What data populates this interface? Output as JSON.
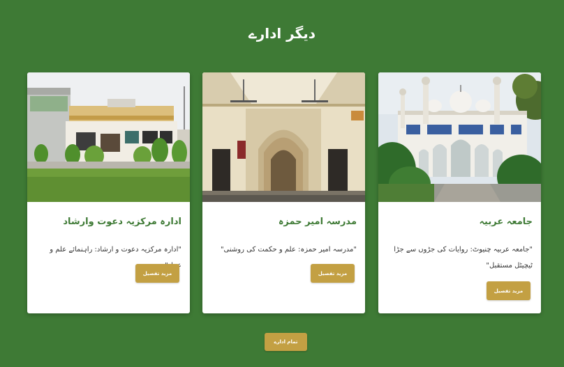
{
  "section": {
    "title": "دیگر ادارے",
    "view_all_label": "تمام ادارے"
  },
  "colors": {
    "background": "#3e7a35",
    "title_green": "#3e7a35",
    "button_gold": "#c3a043",
    "card_bg": "#ffffff"
  },
  "cards": [
    {
      "title": "جامعہ عربیہ",
      "description": "\"جامعہ عربیہ چنیوٹ: روایات کی جڑوں سے جڑا ٹیچیٹل مستقبل\"",
      "button_label": "مزید تفصیل",
      "image": "white mosque with blue tile panels and domes"
    },
    {
      "title": "مدرسہ امیر حمزہ",
      "description": "\"مدرسہ امیر حمزہ: علم و حکمت کی روشنی\"",
      "button_label": "مزید تفصیل",
      "image": "mosque interior with arched mihrab and ceiling fans"
    },
    {
      "title": "ادارہ مرکزیہ دعوت وارشاد",
      "description": "\"ادارہ مرکزیہ دعوت و ارشاد: راہنمائے علم و عمل\"",
      "button_label": "مزید تفصیل",
      "image": "building facade with garden lawn and shrubs"
    }
  ]
}
